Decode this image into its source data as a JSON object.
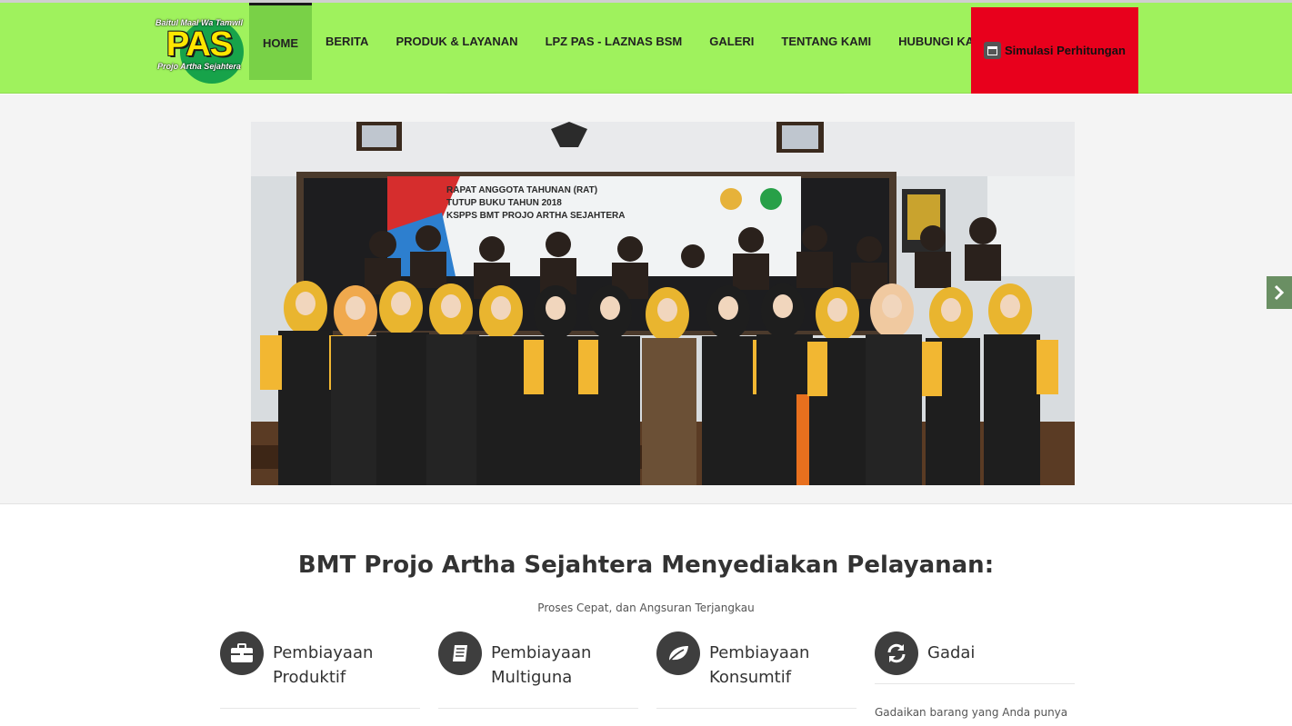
{
  "logo": {
    "top_text": "Baitul Maal Wa Tamwil",
    "main_text": "PAS",
    "bottom_text": "Projo Artha Sejahtera"
  },
  "nav": {
    "items": [
      {
        "label": "HOME",
        "active": true
      },
      {
        "label": "BERITA"
      },
      {
        "label": "PRODUK & LAYANAN"
      },
      {
        "label": "LPZ PAS - LAZNAS BSM"
      },
      {
        "label": "GALERI"
      },
      {
        "label": "TENTANG KAMI"
      },
      {
        "label": "HUBUNGI KAMI"
      }
    ],
    "cta_label": "Simulasi Perhitungan",
    "cta_icon": "calendar-icon"
  },
  "slider": {
    "banner_line1": "RAPAT ANGGOTA TAHUNAN (RAT)",
    "banner_line2": "TUTUP BUKU TAHUN 2018",
    "banner_line3": "KSPPS BMT PROJO ARTHA SEJAHTERA",
    "next_icon": "chevron-right-icon"
  },
  "services": {
    "title": "BMT Projo Artha Sejahtera Menyediakan Pelayanan:",
    "subtitle": "Proses Cepat, dan Angsuran Terjangkau",
    "features": [
      {
        "title": "Pembiayaan Produktif",
        "icon": "briefcase-icon"
      },
      {
        "title": "Pembiayaan Multiguna",
        "icon": "book-icon"
      },
      {
        "title": "Pembiayaan Konsumtif",
        "icon": "leaf-icon"
      },
      {
        "title": "Gadai",
        "icon": "refresh-icon",
        "description": "Gadaikan barang yang Anda punya"
      }
    ]
  },
  "colors": {
    "header_bg": "#9ff25d",
    "nav_active_bg": "#79d147",
    "cta_bg": "#e8001c",
    "icon_circle": "#3e3e3e"
  }
}
